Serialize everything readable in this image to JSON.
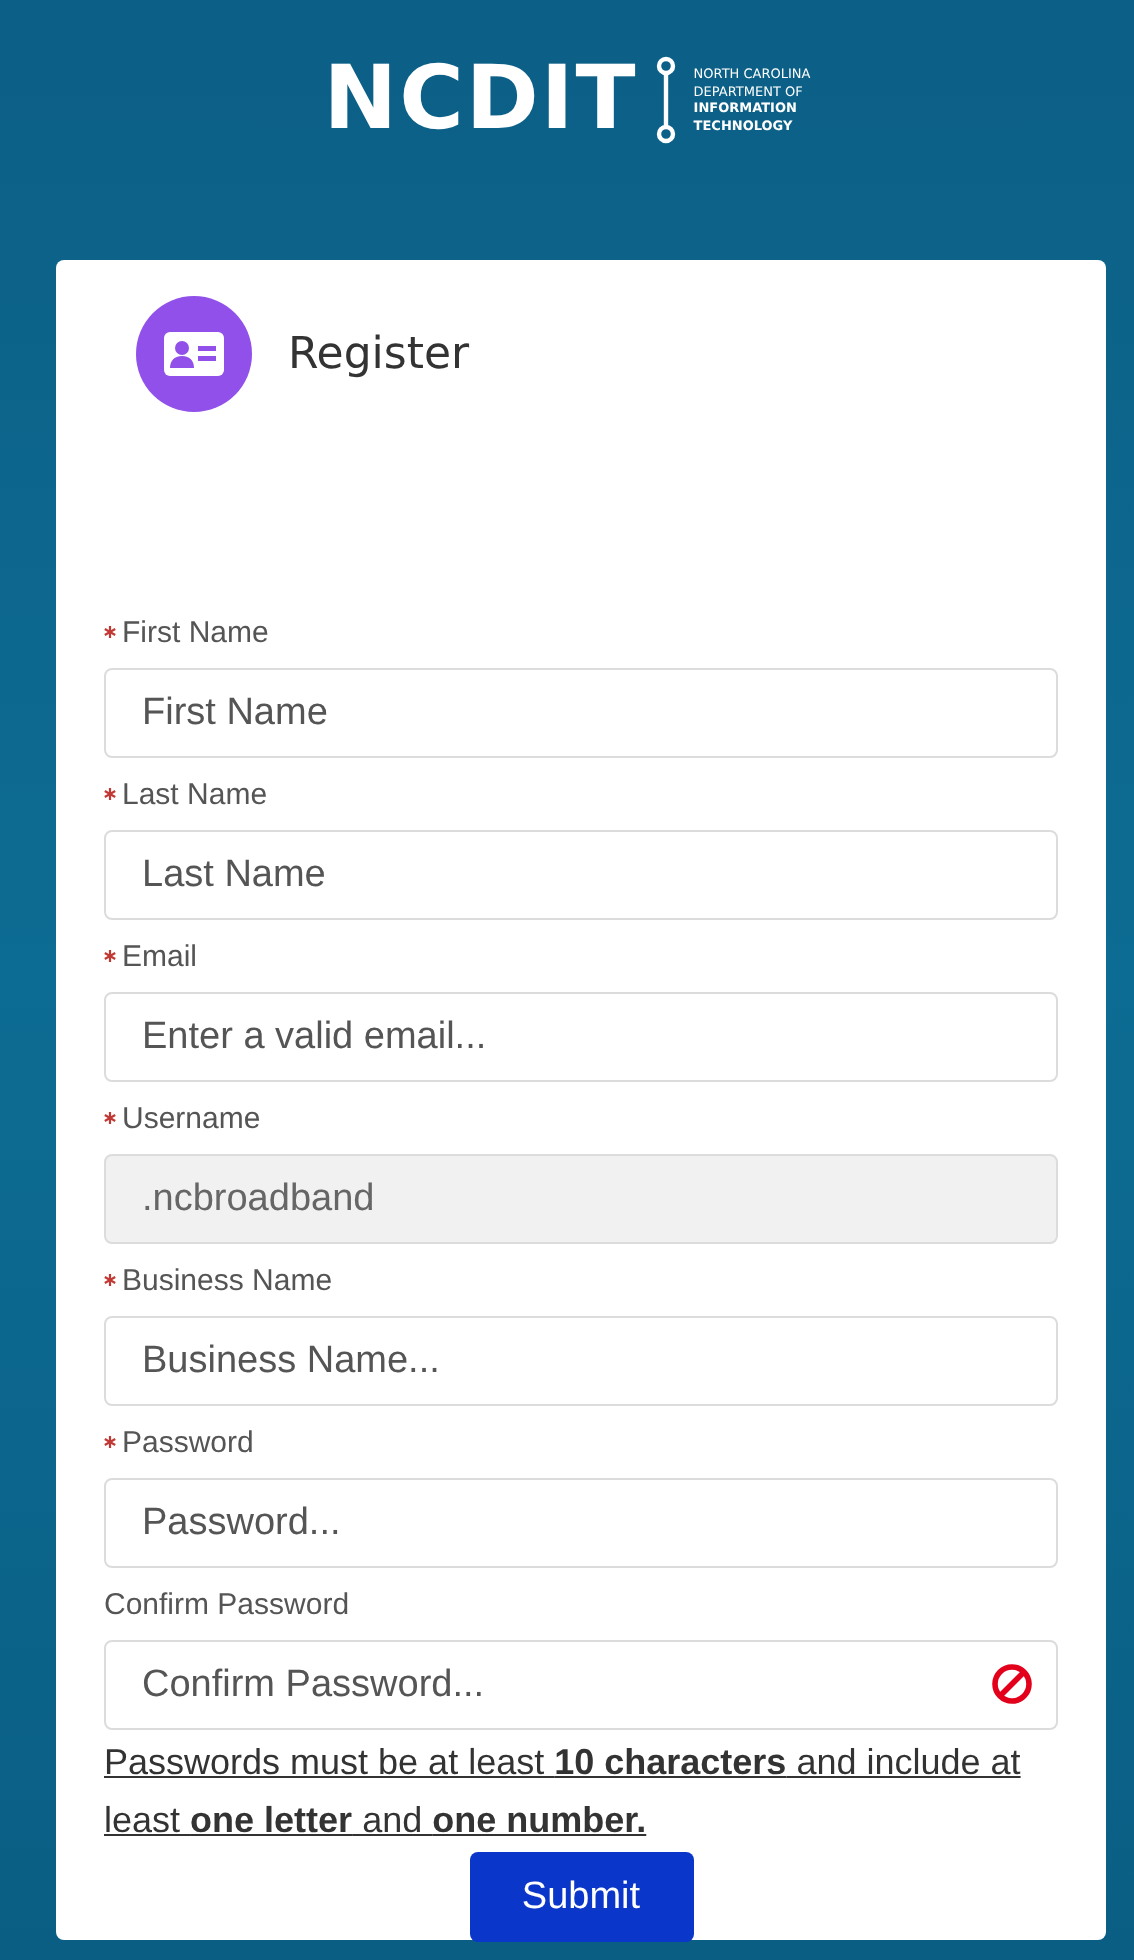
{
  "header": {
    "logo_text": "NCDIT",
    "logo_subtitle": [
      "NORTH CAROLINA",
      "DEPARTMENT OF",
      "INFORMATION",
      "TECHNOLOGY"
    ]
  },
  "card": {
    "title": "Register"
  },
  "fields": [
    {
      "label": "First Name",
      "required": true,
      "placeholder": "First Name",
      "disabled": false,
      "error": false
    },
    {
      "label": "Last Name",
      "required": true,
      "placeholder": "Last Name",
      "disabled": false,
      "error": false
    },
    {
      "label": "Email",
      "required": true,
      "placeholder": "Enter a valid email...",
      "disabled": false,
      "error": false
    },
    {
      "label": "Username",
      "required": true,
      "value": ".ncbroadband",
      "disabled": true,
      "error": false
    },
    {
      "label": "Business Name",
      "required": true,
      "placeholder": "Business Name...",
      "disabled": false,
      "error": false
    },
    {
      "label": "Password",
      "required": true,
      "placeholder": "Password...",
      "disabled": false,
      "error": false
    },
    {
      "label": "Confirm Password",
      "required": false,
      "placeholder": "Confirm Password...",
      "disabled": false,
      "error": true
    }
  ],
  "password_hint": "Passwords must be at least **10 characters** and include at least **one letter** and **one number.**",
  "submit_button": "Submit"
}
